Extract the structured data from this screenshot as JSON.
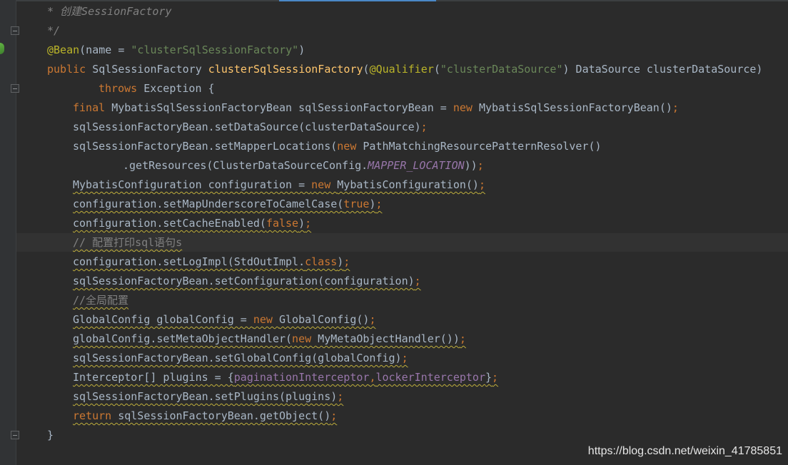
{
  "editor": {
    "background": "#2b2b2b",
    "colors": {
      "keyword": "#cc7832",
      "annotation": "#bbb529",
      "string": "#6a8759",
      "method_decl": "#ffc66d",
      "comment": "#808080",
      "constant": "#9876aa",
      "plain": "#a9b7c6"
    },
    "gutter_icons": [
      "fold-icon",
      "spring-bean-icon",
      "fold-icon",
      "fold-icon"
    ],
    "lines": [
      {
        "indent": 1,
        "segments": [
          {
            "t": "* 创建SessionFactory",
            "c": "cmt"
          }
        ]
      },
      {
        "indent": 1,
        "segments": [
          {
            "t": "*/",
            "c": "cmt"
          }
        ]
      },
      {
        "indent": 1,
        "segments": [
          {
            "t": "@Bean",
            "c": "ann"
          },
          {
            "t": "(name = ",
            "c": ""
          },
          {
            "t": "\"clusterSqlSessionFactory\"",
            "c": "str"
          },
          {
            "t": ")",
            "c": ""
          }
        ]
      },
      {
        "indent": 1,
        "segments": [
          {
            "t": "public ",
            "c": "kw"
          },
          {
            "t": "SqlSessionFactory ",
            "c": ""
          },
          {
            "t": "clusterSqlSessionFactory",
            "c": "fn"
          },
          {
            "t": "(",
            "c": ""
          },
          {
            "t": "@Qualifier",
            "c": "ann"
          },
          {
            "t": "(",
            "c": ""
          },
          {
            "t": "\"clusterDataSource\"",
            "c": "str"
          },
          {
            "t": ") DataSource clusterDataSource)",
            "c": ""
          }
        ]
      },
      {
        "indent": 3,
        "segments": [
          {
            "t": "throws ",
            "c": "kw"
          },
          {
            "t": "Exception {",
            "c": ""
          }
        ]
      },
      {
        "indent": 2,
        "segments": [
          {
            "t": "final ",
            "c": "kw"
          },
          {
            "t": "MybatisSqlSessionFactoryBean sqlSessionFactoryBean = ",
            "c": ""
          },
          {
            "t": "new ",
            "c": "kw"
          },
          {
            "t": "MybatisSqlSessionFactoryBean()",
            "c": ""
          },
          {
            "t": ";",
            "c": "kw"
          }
        ]
      },
      {
        "indent": 2,
        "segments": [
          {
            "t": "sqlSessionFactoryBean.setDataSource(clusterDataSource)",
            "c": ""
          },
          {
            "t": ";",
            "c": "kw"
          }
        ]
      },
      {
        "indent": 2,
        "segments": [
          {
            "t": "sqlSessionFactoryBean.setMapperLocations(",
            "c": ""
          },
          {
            "t": "new ",
            "c": "kw"
          },
          {
            "t": "PathMatchingResourcePatternResolver()",
            "c": ""
          }
        ]
      },
      {
        "indent": 4,
        "segments": [
          {
            "t": ".getResources(ClusterDataSourceConfig.",
            "c": ""
          },
          {
            "t": "MAPPER_LOCATION",
            "c": "const"
          },
          {
            "t": "))",
            "c": ""
          },
          {
            "t": ";",
            "c": "kw"
          }
        ]
      },
      {
        "indent": 2,
        "warn": true,
        "segments": [
          {
            "t": "MybatisConfiguration configuration = ",
            "c": ""
          },
          {
            "t": "new ",
            "c": "kw"
          },
          {
            "t": "MybatisConfiguration()",
            "c": ""
          },
          {
            "t": ";",
            "c": "kw"
          }
        ]
      },
      {
        "indent": 2,
        "warn": true,
        "segments": [
          {
            "t": "configuration.setMapUnderscoreToCamelCase(",
            "c": ""
          },
          {
            "t": "true",
            "c": "kw"
          },
          {
            "t": ")",
            "c": ""
          },
          {
            "t": ";",
            "c": "kw"
          }
        ]
      },
      {
        "indent": 2,
        "warn": true,
        "segments": [
          {
            "t": "configuration.setCacheEnabled(",
            "c": ""
          },
          {
            "t": "false",
            "c": "kw"
          },
          {
            "t": ")",
            "c": ""
          },
          {
            "t": ";",
            "c": "kw"
          }
        ]
      },
      {
        "indent": 2,
        "warn": true,
        "segments": [
          {
            "t": "// 配置打印sql语句s",
            "c": "cmt2"
          }
        ]
      },
      {
        "indent": 2,
        "warn": true,
        "segments": [
          {
            "t": "configuration.setLogImpl(StdOutImpl.",
            "c": ""
          },
          {
            "t": "class",
            "c": "kw"
          },
          {
            "t": ")",
            "c": ""
          },
          {
            "t": ";",
            "c": "kw"
          }
        ]
      },
      {
        "indent": 2,
        "warn": true,
        "segments": [
          {
            "t": "sqlSessionFactoryBean.setConfiguration(configuration)",
            "c": ""
          },
          {
            "t": ";",
            "c": "kw"
          }
        ]
      },
      {
        "indent": 2,
        "warn": true,
        "segments": [
          {
            "t": "//全局配置",
            "c": "cmt2"
          }
        ]
      },
      {
        "indent": 2,
        "warn": true,
        "segments": [
          {
            "t": "GlobalConfig globalConfig = ",
            "c": ""
          },
          {
            "t": "new ",
            "c": "kw"
          },
          {
            "t": "GlobalConfig()",
            "c": ""
          },
          {
            "t": ";",
            "c": "kw"
          }
        ]
      },
      {
        "indent": 2,
        "warn": true,
        "segments": [
          {
            "t": "globalConfig.setMetaObjectHandler(",
            "c": ""
          },
          {
            "t": "new ",
            "c": "kw"
          },
          {
            "t": "MyMetaObjectHandler())",
            "c": ""
          },
          {
            "t": ";",
            "c": "kw"
          }
        ]
      },
      {
        "indent": 2,
        "warn": true,
        "segments": [
          {
            "t": "sqlSessionFactoryBean.setGlobalConfig(globalConfig)",
            "c": ""
          },
          {
            "t": ";",
            "c": "kw"
          }
        ]
      },
      {
        "indent": 2,
        "warn": true,
        "segments": [
          {
            "t": "Interceptor[] plugins = {",
            "c": ""
          },
          {
            "t": "paginationInterceptor",
            "c": "field"
          },
          {
            "t": ",",
            "c": "kw"
          },
          {
            "t": "lockerInterceptor",
            "c": "field"
          },
          {
            "t": "}",
            "c": ""
          },
          {
            "t": ";",
            "c": "kw"
          }
        ]
      },
      {
        "indent": 2,
        "warn": true,
        "segments": [
          {
            "t": "sqlSessionFactoryBean.setPlugins(plugins)",
            "c": ""
          },
          {
            "t": ";",
            "c": "kw"
          }
        ]
      },
      {
        "indent": 2,
        "warn": true,
        "segments": [
          {
            "t": "return ",
            "c": "kw"
          },
          {
            "t": "sqlSessionFactoryBean.getObject()",
            "c": ""
          },
          {
            "t": ";",
            "c": "kw"
          }
        ]
      },
      {
        "indent": 1,
        "segments": [
          {
            "t": "}",
            "c": ""
          }
        ]
      }
    ]
  },
  "watermark": "https://blog.csdn.net/weixin_41785851"
}
